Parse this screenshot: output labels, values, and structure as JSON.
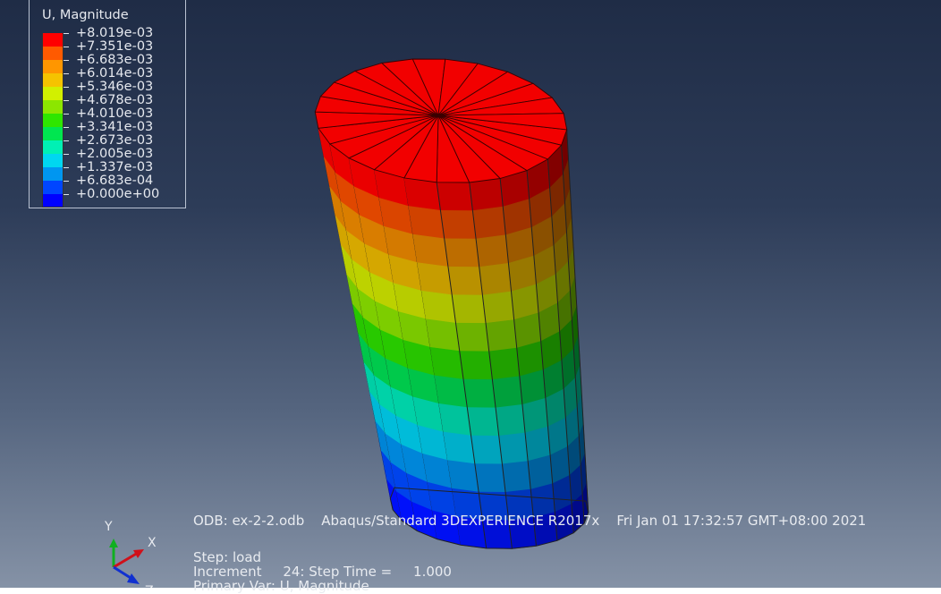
{
  "legend": {
    "title": "U, Magnitude",
    "entries": [
      {
        "label": "+8.019e-03",
        "color": "#ff0000"
      },
      {
        "label": "+7.351e-03",
        "color": "#ff5a00"
      },
      {
        "label": "+6.683e-03",
        "color": "#ff9600"
      },
      {
        "label": "+6.014e-03",
        "color": "#f5c300"
      },
      {
        "label": "+5.346e-03",
        "color": "#d2f000"
      },
      {
        "label": "+4.678e-03",
        "color": "#8ce600"
      },
      {
        "label": "+4.010e-03",
        "color": "#2ee600"
      },
      {
        "label": "+3.341e-03",
        "color": "#00e650"
      },
      {
        "label": "+2.673e-03",
        "color": "#00f0b4"
      },
      {
        "label": "+2.005e-03",
        "color": "#00d7f0"
      },
      {
        "label": "+1.337e-03",
        "color": "#0096f0"
      },
      {
        "label": "+6.683e-04",
        "color": "#0046ff"
      },
      {
        "label": "+0.000e+00",
        "color": "#0000ff"
      }
    ]
  },
  "model": {
    "band_colors": [
      "#e00000",
      "#d64400",
      "#d07800",
      "#cca000",
      "#b4c800",
      "#78c400",
      "#26c000",
      "#00c048",
      "#00c8a0",
      "#00b4d0",
      "#0080d0",
      "#0040e0",
      "#0010ee"
    ],
    "cap_color": "#f20000"
  },
  "info": {
    "odb_line": "ODB: ex-2-2.odb    Abaqus/Standard 3DEXPERIENCE R2017x    Fri Jan 01 17:32:57 GMT+08:00 2021",
    "step_line": "Step: load",
    "increment_line": "Increment     24: Step Time =     1.000",
    "primary_var_line": "Primary Var: U, Magnitude"
  },
  "triad": {
    "x_label": "X",
    "y_label": "Y",
    "z_label": "Z",
    "colors": {
      "x": "#d0101a",
      "y": "#10b020",
      "z": "#1030d0"
    }
  }
}
